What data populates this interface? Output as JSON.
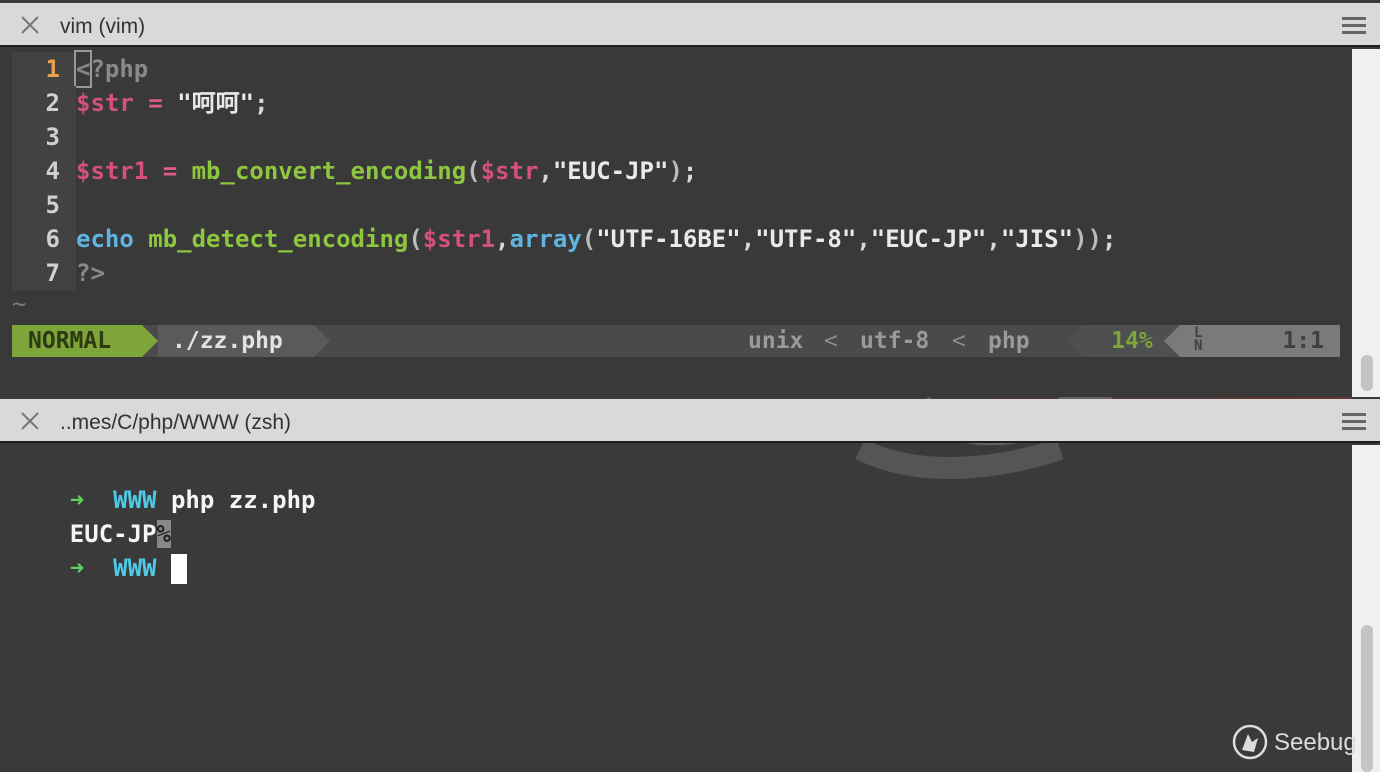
{
  "top_tab": {
    "title": "vim (vim)"
  },
  "bottom_tab": {
    "title": "..mes/C/php/WWW (zsh)"
  },
  "editor": {
    "lines": [
      {
        "num": "1",
        "parts": [
          [
            "cur",
            "<"
          ],
          [
            "dim",
            "?php"
          ]
        ]
      },
      {
        "num": "2",
        "parts": [
          [
            "var",
            "$str"
          ],
          [
            "op",
            " = "
          ],
          [
            "str",
            "\"呵呵\""
          ],
          [
            "plain",
            ";"
          ]
        ]
      },
      {
        "num": "3",
        "parts": []
      },
      {
        "num": "4",
        "parts": [
          [
            "var",
            "$str1"
          ],
          [
            "op",
            " = "
          ],
          [
            "fn",
            "mb_convert_encoding"
          ],
          [
            "paren",
            "("
          ],
          [
            "var",
            "$str"
          ],
          [
            "plain",
            ","
          ],
          [
            "str",
            "\"EUC-JP\""
          ],
          [
            "paren",
            ")"
          ],
          [
            "plain",
            ";"
          ]
        ]
      },
      {
        "num": "5",
        "parts": []
      },
      {
        "num": "6",
        "parts": [
          [
            "kw",
            "echo"
          ],
          [
            "plain",
            " "
          ],
          [
            "fn",
            "mb_detect_encoding"
          ],
          [
            "paren",
            "("
          ],
          [
            "var",
            "$str1"
          ],
          [
            "plain",
            ","
          ],
          [
            "kw",
            "array"
          ],
          [
            "paren",
            "("
          ],
          [
            "str",
            "\"UTF-16BE\""
          ],
          [
            "plain",
            ","
          ],
          [
            "str",
            "\"UTF-8\""
          ],
          [
            "plain",
            ","
          ],
          [
            "str",
            "\"EUC-JP\""
          ],
          [
            "plain",
            ","
          ],
          [
            "str",
            "\"JIS\""
          ],
          [
            "paren",
            "))"
          ],
          [
            "plain",
            ";"
          ]
        ]
      },
      {
        "num": "7",
        "parts": [
          [
            "dim",
            "?>"
          ]
        ]
      }
    ],
    "tilde": "~"
  },
  "statusline": {
    "mode": "NORMAL",
    "file": "./zz.php",
    "fileformat": "unix",
    "encoding": "utf-8",
    "filetype": "php",
    "percent": "14%",
    "ln_icon": "LN",
    "position": "1:1",
    "sep_left": "<"
  },
  "terminal": {
    "prompt_arrow": "➜",
    "dir": "WWW",
    "command": "php zz.php",
    "output": "EUC-JP",
    "no_newline_mark": "%"
  },
  "watermark": {
    "text": "Seebug"
  },
  "colors": {
    "mode_bg": "#7da53a",
    "keyword_blue": "#5fb4e0",
    "var_pink": "#d6517a",
    "fn_green": "#8dc63f"
  }
}
